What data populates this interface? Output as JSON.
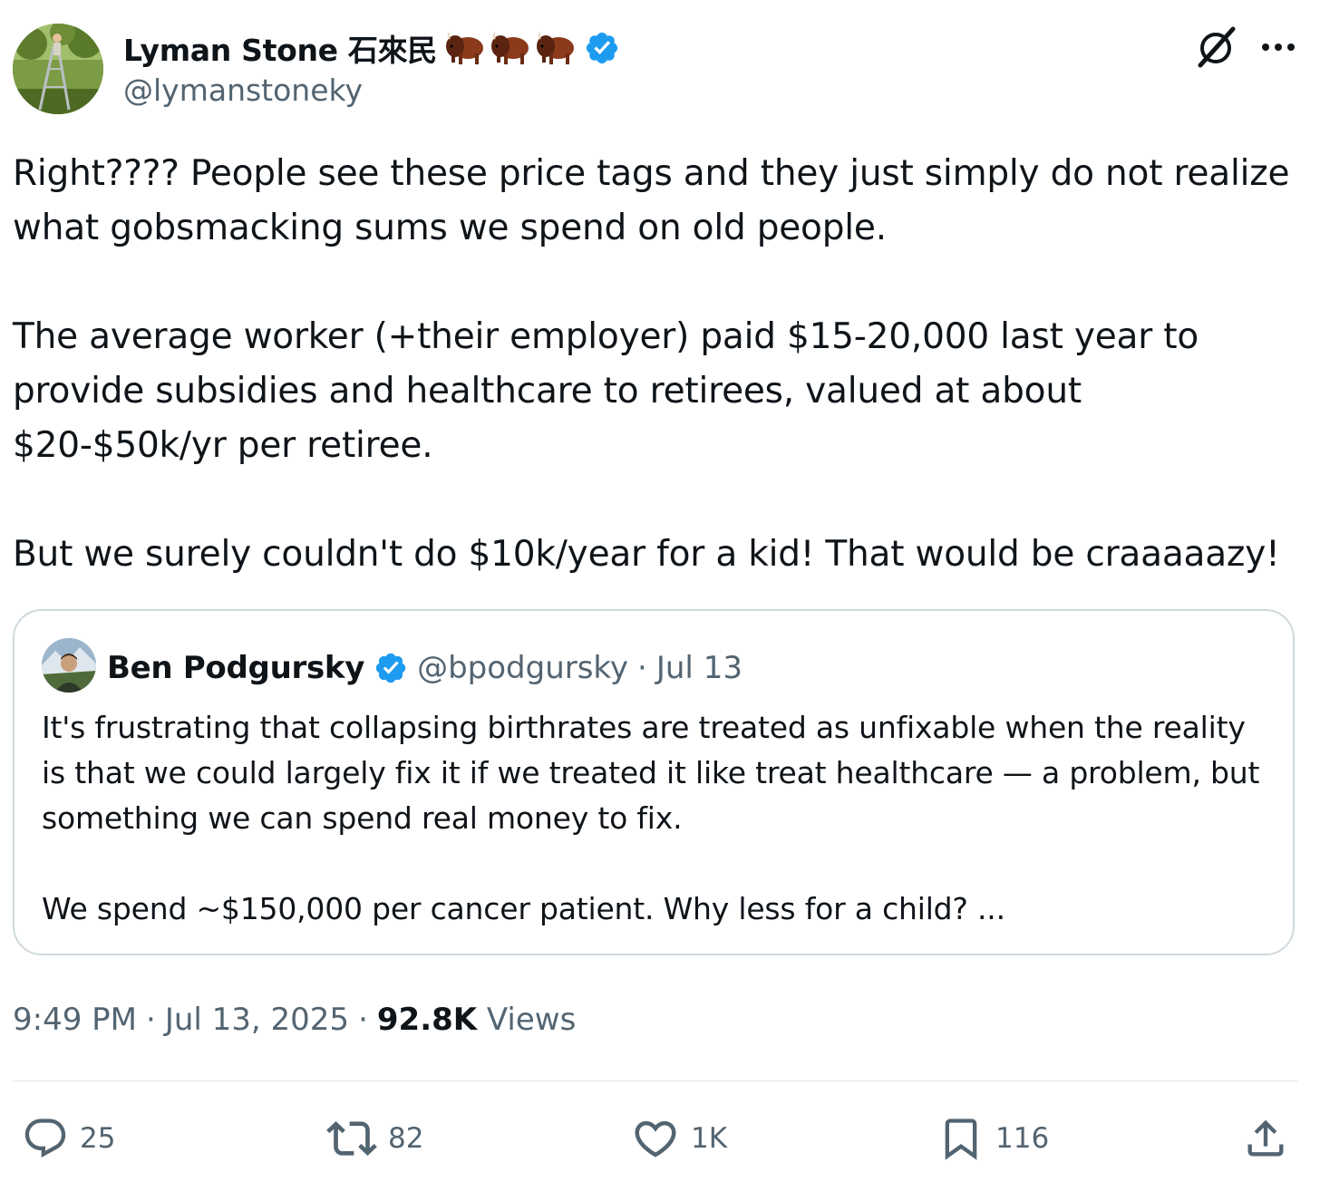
{
  "author": {
    "display_name": "Lyman Stone 石來民",
    "emoji": "🦬🦬🦬",
    "handle": "@lymanstoneky",
    "verified": true
  },
  "header_icons": [
    "grok-icon",
    "more-icon"
  ],
  "tweet": {
    "text": "Right???? People see these price tags and they just simply do not realize what gobsmacking sums we spend on old people.\n\nThe average worker (+their employer) paid $15-20,000 last year to provide subsidies and healthcare to retirees, valued at about $20-$50k/yr per retiree.\n\nBut we surely couldn't do $10k/year for a kid! That would be craaaaazy!"
  },
  "quote": {
    "display_name": "Ben Podgursky",
    "handle": "@bpodgursky",
    "separator": "·",
    "date": "Jul 13",
    "verified": true,
    "text": "It's frustrating that collapsing birthrates are treated as unfixable when the reality is that we could largely fix it if we treated it like treat healthcare — a problem, but something we can spend real money to fix.\n\nWe spend ~$150,000 per cancer patient. Why less for a child? ..."
  },
  "meta": {
    "time": "9:49 PM",
    "sep1": "·",
    "date": "Jul 13, 2025",
    "sep2": "·",
    "views_count": "92.8K",
    "views_label": "Views"
  },
  "actions": {
    "replies": "25",
    "reposts": "82",
    "likes": "1K",
    "bookmarks": "116"
  },
  "colors": {
    "text": "#0f1419",
    "secondary": "#536471",
    "verified": "#1d9bf0",
    "border": "#cfd9de"
  }
}
